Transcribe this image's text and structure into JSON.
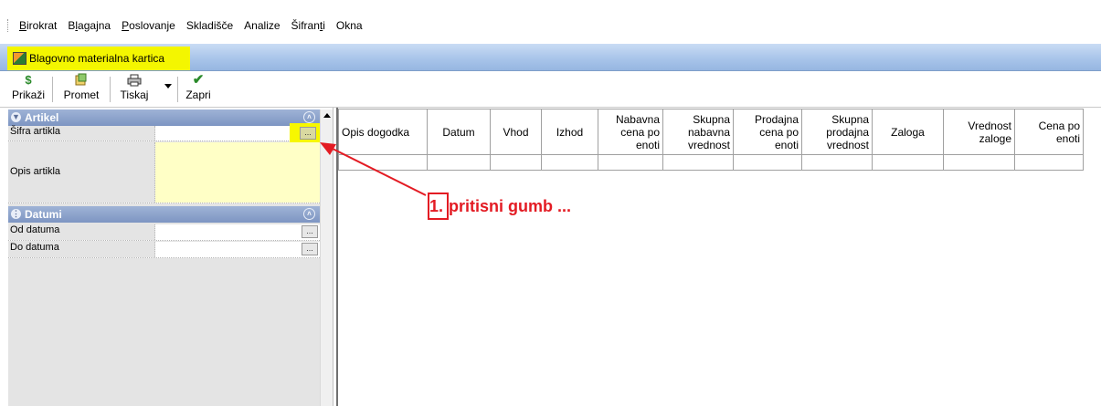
{
  "menu": {
    "items": [
      {
        "pre": "",
        "u": "B",
        "post": "irokrat"
      },
      {
        "pre": "B",
        "u": "l",
        "post": "agajna"
      },
      {
        "pre": "",
        "u": "P",
        "post": "oslovanje"
      },
      {
        "pre": "Skladišče",
        "u": "",
        "post": ""
      },
      {
        "pre": "Analize",
        "u": "",
        "post": ""
      },
      {
        "pre": "Šifran",
        "u": "t",
        "post": "i"
      },
      {
        "pre": "Okna",
        "u": "",
        "post": ""
      }
    ]
  },
  "window": {
    "title": "Blagovno materialna kartica",
    "highlight_color": "#f4f600"
  },
  "toolbar": {
    "prikazi_label": "Prikaži",
    "prikazi_icon": "$",
    "promet_label": "Promet",
    "tiskaj_label": "Tiskaj",
    "tiskaj_icon": "🖶",
    "zapri_label": "Zapri",
    "zapri_icon": "✔"
  },
  "left_panel": {
    "artikel": {
      "header": "Artikel",
      "sifra_label": "Šifra artikla",
      "sifra_value": "",
      "opis_label": "Opis artikla",
      "opis_value": "",
      "ellipsis": "..."
    },
    "datumi": {
      "header": "Datumi",
      "od_label": "Od datuma",
      "od_value": "",
      "do_label": "Do datuma",
      "do_value": "",
      "ellipsis": "..."
    }
  },
  "grid": {
    "columns": [
      {
        "lines": [
          "Opis dogodka"
        ],
        "align": "l"
      },
      {
        "lines": [
          "Datum"
        ],
        "align": "c"
      },
      {
        "lines": [
          "Vhod"
        ],
        "align": "c"
      },
      {
        "lines": [
          "Izhod"
        ],
        "align": "c"
      },
      {
        "lines": [
          "Nabavna",
          "cena po",
          "enoti"
        ],
        "align": "r"
      },
      {
        "lines": [
          "Skupna",
          "nabavna",
          "vrednost"
        ],
        "align": "r"
      },
      {
        "lines": [
          "Prodajna",
          "cena po",
          "enoti"
        ],
        "align": "r"
      },
      {
        "lines": [
          "Skupna",
          "prodajna",
          "vrednost"
        ],
        "align": "r"
      },
      {
        "lines": [
          "Zaloga"
        ],
        "align": "c"
      },
      {
        "lines": [
          "Vrednost",
          "zaloge"
        ],
        "align": "r"
      },
      {
        "lines": [
          "Cena po",
          "enoti"
        ],
        "align": "r"
      }
    ]
  },
  "annotation": {
    "number": "1.",
    "text": "pritisni gumb  ...",
    "color": "#e31b23"
  }
}
